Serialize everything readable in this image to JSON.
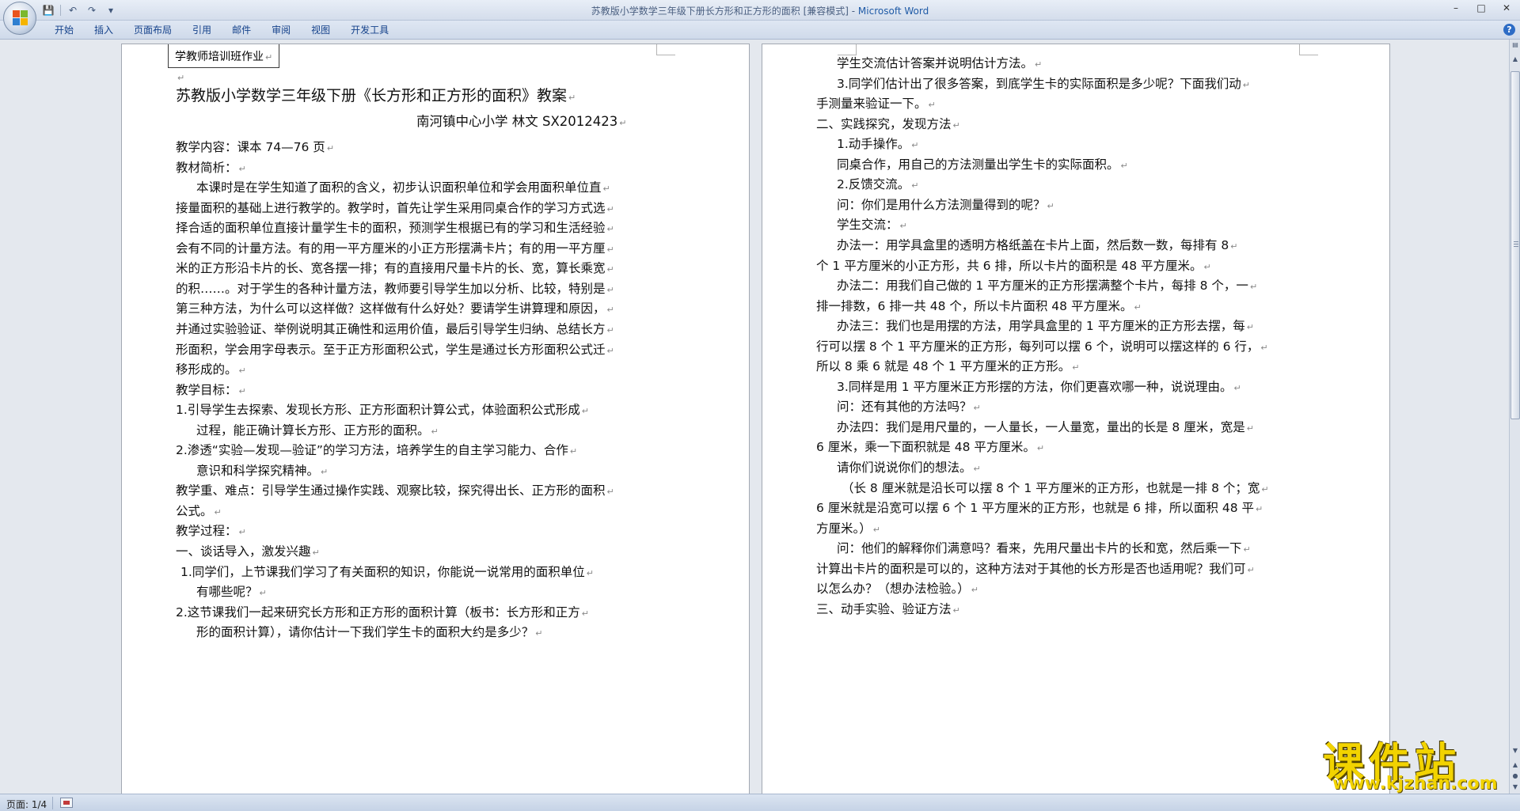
{
  "window": {
    "title": "苏教版小学数学三年级下册长方形和正方形的面积 [兼容模式] - ",
    "app_name": "Microsoft Word",
    "accent_color": "#1f5aa6"
  },
  "quick_access": [
    "save-icon",
    "undo-icon",
    "redo-icon",
    "customize-icon"
  ],
  "ribbon": {
    "tabs": [
      "开始",
      "插入",
      "页面布局",
      "引用",
      "邮件",
      "审阅",
      "视图",
      "开发工具"
    ]
  },
  "status": {
    "page": "页面: 1/4"
  },
  "watermark": {
    "main": "课件站",
    "url": "www.kjzhan.com"
  },
  "doc_left": {
    "header": "学教师培训班作业",
    "title": "苏教版小学数学三年级下册《长方形和正方形的面积》教案",
    "author": "南河镇中心小学  林文  SX2012423",
    "lines": [
      "教学内容：课本 74—76 页",
      "教材简析：",
      "本课时是在学生知道了面积的含义，初步认识面积单位和学会用面积单位直",
      "接量面积的基础上进行教学的。教学时，首先让学生采用同桌合作的学习方式选",
      "择合适的面积单位直接计量学生卡的面积，预测学生根据已有的学习和生活经验",
      "会有不同的计量方法。有的用一平方厘米的小正方形摆满卡片；有的用一平方厘",
      "米的正方形沿卡片的长、宽各摆一排；有的直接用尺量卡片的长、宽，算长乘宽",
      "的积……。对于学生的各种计量方法，教师要引导学生加以分析、比较，特别是",
      "第三种方法，为什么可以这样做？这样做有什么好处？要请学生讲算理和原因，",
      "并通过实验验证、举例说明其正确性和运用价值，最后引导学生归纳、总结长方",
      "形面积，学会用字母表示。至于正方形面积公式，学生是通过长方形面积公式迁",
      "移形成的。",
      "教学目标：",
      "1.引导学生去探索、发现长方形、正方形面积计算公式，体验面积公式形成",
      "过程，能正确计算长方形、正方形的面积。",
      "2.渗透“实验—发现—验证”的学习方法，培养学生的自主学习能力、合作",
      "意识和科学探究精神。",
      "教学重、难点：引导学生通过操作实践、观察比较，探究得出长、正方形的面积",
      "公式。",
      "教学过程：",
      "一、谈话导入，激发兴趣",
      "1.同学们，上节课我们学习了有关面积的知识，你能说一说常用的面积单位",
      "有哪些呢？",
      "2.这节课我们一起来研究长方形和正方形的面积计算（板书：长方形和正方",
      "形的面积计算），请你估计一下我们学生卡的面积大约是多少？"
    ]
  },
  "doc_right": {
    "lines": [
      "学生交流估计答案并说明估计方法。",
      "3.同学们估计出了很多答案，到底学生卡的实际面积是多少呢？下面我们动",
      "手测量来验证一下。",
      "二、实践探究，发现方法",
      "1.动手操作。",
      "同桌合作，用自己的方法测量出学生卡的实际面积。",
      "2.反馈交流。",
      "问：你们是用什么方法测量得到的呢？",
      "学生交流：",
      "办法一：用学具盒里的透明方格纸盖在卡片上面，然后数一数，每排有 8",
      "个 1 平方厘米的小正方形，共 6 排，所以卡片的面积是 48 平方厘米。",
      "办法二：用我们自己做的 1 平方厘米的正方形摆满整个卡片，每排 8 个，一",
      "排一排数，6 排一共 48 个，所以卡片面积 48 平方厘米。",
      "办法三：我们也是用摆的方法，用学具盒里的 1 平方厘米的正方形去摆，每",
      "行可以摆 8 个 1 平方厘米的正方形，每列可以摆 6 个，说明可以摆这样的 6 行，",
      "所以 8 乘 6 就是 48 个 1 平方厘米的正方形。",
      "3.同样是用 1 平方厘米正方形摆的方法，你们更喜欢哪一种，说说理由。",
      "问：还有其他的方法吗？",
      "办法四：我们是用尺量的，一人量长，一人量宽，量出的长是 8 厘米，宽是",
      "6 厘米，乘一下面积就是 48 平方厘米。",
      "请你们说说你们的想法。",
      "（长 8 厘米就是沿长可以摆 8 个 1 平方厘米的正方形，也就是一排 8 个；宽",
      "6 厘米就是沿宽可以摆 6 个 1 平方厘米的正方形，也就是 6 排，所以面积 48 平",
      "方厘米。）",
      "问：他们的解释你们满意吗？看来，先用尺量出卡片的长和宽，然后乘一下",
      "计算出卡片的面积是可以的，这种方法对于其他的长方形是否也适用呢？我们可",
      "以怎么办？（想办法检验。）",
      "三、动手实验、验证方法"
    ]
  }
}
